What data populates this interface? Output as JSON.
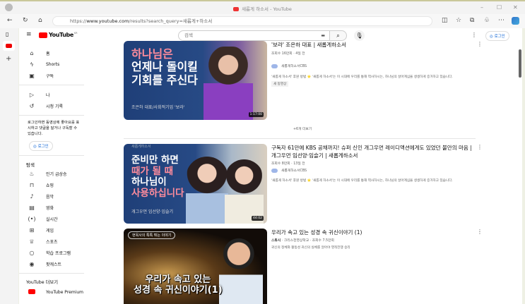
{
  "browser": {
    "tab_title": "새롭게 하소서 - YouTube",
    "url_prefix": "https://",
    "url_domain": "www.youtube.com",
    "url_path": "/results?search_query=새롭게+하소서"
  },
  "header": {
    "logo": "YouTube",
    "region": "KR",
    "search_placeholder": "검색",
    "login": "로그인"
  },
  "sidebar": {
    "main": [
      {
        "label": "홈",
        "icon": "home-icon"
      },
      {
        "label": "Shorts",
        "icon": "shorts-icon"
      },
      {
        "label": "구독",
        "icon": "subscriptions-icon"
      }
    ],
    "you": [
      {
        "label": "나",
        "icon": "library-icon"
      },
      {
        "label": "시청 기록",
        "icon": "history-icon"
      }
    ],
    "login_prompt": "로그인하면 동영상에 좋아요를 표시하고 댓글을 달거나 구독할 수 있습니다.",
    "login_button": "로그인",
    "explore_title": "탐색",
    "explore": [
      {
        "label": "인기 급상승"
      },
      {
        "label": "쇼핑"
      },
      {
        "label": "음악"
      },
      {
        "label": "영화"
      },
      {
        "label": "실시간"
      },
      {
        "label": "게임"
      },
      {
        "label": "스포츠"
      },
      {
        "label": "학습 프로그램"
      },
      {
        "label": "팟캐스트"
      }
    ],
    "more_title": "YouTube 더보기",
    "premium": "YouTube Premium"
  },
  "results": [
    {
      "title_line0": "'보라' 조은하 대표 | 새롭게하소서",
      "meta": "조회수 16만회 · 4일 전",
      "channel": "새롭게하소서CBS",
      "desc": "'새롭게 하소서' 후원 방법 ⭐ '새롭게 하소서'는 이 시대에 우리를 통해 역사하시는, 하나님의 살아계심을 생생하게 증거하고 있습니다.",
      "badge": "새 동영상",
      "thumb_lines": [
        "하나님은",
        "언제나 돌이킬",
        "기회를 주신다"
      ],
      "thumb_sub": "조은하 대표/사회적기업 '보라'",
      "duration": "1:17:00"
    },
    {
      "title": "구독자 61만에 KBS 공채까지! 슈퍼 신인 개그우먼 레이디액션에게도 있었던 불안의 마음 | 개그우먼 임선양·임슬기 | 새롭게하소서",
      "meta": "조회수 8만회 · 13일 전",
      "channel": "새롭게하소서CBS",
      "desc": "'새롭게 하소서' 후원 방법 ⭐ '새롭게 하소서'는 이 시대에 우리를 통해 역사하시는, 하나님의 살아계심을 생생하게 증거하고 있습니다.",
      "thumb_brand": "새롭게하소서",
      "thumb_lines": [
        "준비만 하면",
        "때가 될 때",
        "하나님이",
        "사용하십니다"
      ],
      "thumb_sub": "개그우먼 임선양·임슬기",
      "duration": "44:02"
    },
    {
      "title": "우리가 속고 있는 성경 속 귀신이야기 (1)",
      "meta_author": "스튜시",
      "meta": "· 크리스천영상학교 · 조회수 7.5만회",
      "desc": "귀신의 정체와 활동성 귀신의 실체를 알아야 영적전쟁 승리",
      "thumb_tag": "현목사의 톡톡 튀는 이야기",
      "thumb_lines": [
        "우리가 속고 있는",
        "성경 속 귀신이야기(1)"
      ]
    }
  ],
  "show_more": "+6개 더보기"
}
